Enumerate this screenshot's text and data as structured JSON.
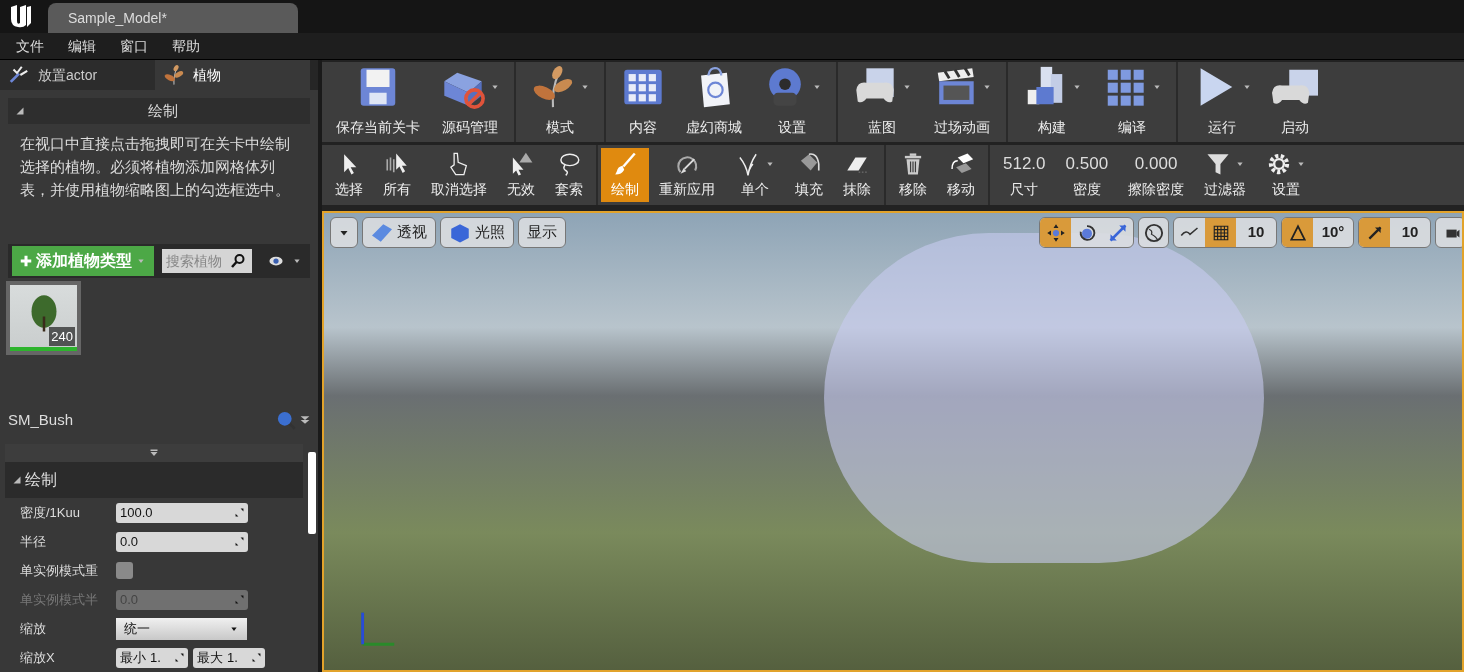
{
  "window": {
    "tab_title": "Sample_Model*"
  },
  "menu": [
    "文件",
    "编辑",
    "窗口",
    "帮助"
  ],
  "mode_tabs": [
    {
      "label": "放置actor",
      "selected": false
    },
    {
      "label": "植物",
      "selected": true
    }
  ],
  "paint_panel": {
    "header": "绘制",
    "description": "在视口中直接点击拖拽即可在关卡中绘制选择的植物。必须将植物添加网格体列表，并使用植物缩略图上的勾选框选中。",
    "add_button": "添加植物类型",
    "search": {
      "placeholder": "搜索植物"
    },
    "foliage_items": [
      {
        "count": "240",
        "selected": true
      }
    ]
  },
  "details": {
    "title": "SM_Bush",
    "section": "绘制",
    "properties": [
      {
        "kind": "number",
        "label": "密度/1Kuu",
        "value": "100.0",
        "disabled": false
      },
      {
        "kind": "number",
        "label": "半径",
        "value": "0.0",
        "disabled": false
      },
      {
        "kind": "checkbox",
        "label": "单实例模式重",
        "checked": false
      },
      {
        "kind": "number",
        "label": "单实例模式半",
        "value": "0.0",
        "disabled": true
      },
      {
        "kind": "dropdown",
        "label": "缩放",
        "value": "统一"
      },
      {
        "kind": "range",
        "label": "缩放X",
        "min_label": "最小",
        "min": "1.",
        "max_label": "最大",
        "max": "1."
      }
    ]
  },
  "main_toolbar": {
    "groups": [
      [
        {
          "label": "保存当前关卡",
          "dropdown": false
        },
        {
          "label": "源码管理",
          "dropdown": true
        }
      ],
      [
        {
          "label": "模式",
          "dropdown": true
        }
      ],
      [
        {
          "label": "内容",
          "dropdown": false
        },
        {
          "label": "虚幻商城",
          "dropdown": false
        },
        {
          "label": "设置",
          "dropdown": true
        }
      ],
      [
        {
          "label": "蓝图",
          "dropdown": true
        },
        {
          "label": "过场动画",
          "dropdown": true
        }
      ],
      [
        {
          "label": "构建",
          "dropdown": true
        },
        {
          "label": "编译",
          "dropdown": true
        }
      ],
      [
        {
          "label": "运行",
          "dropdown": true
        },
        {
          "label": "启动",
          "dropdown": false
        }
      ]
    ]
  },
  "foliage_toolbar": {
    "groups": [
      [
        {
          "kind": "tool",
          "label": "选择",
          "selected": false,
          "dropdown": false
        },
        {
          "kind": "tool",
          "label": "所有",
          "selected": false,
          "dropdown": false
        },
        {
          "kind": "tool",
          "label": "取消选择",
          "selected": false,
          "dropdown": false
        },
        {
          "kind": "tool",
          "label": "无效",
          "selected": false,
          "dropdown": false
        },
        {
          "kind": "tool",
          "label": "套索",
          "selected": false,
          "dropdown": false
        }
      ],
      [
        {
          "kind": "tool",
          "label": "绘制",
          "selected": true,
          "dropdown": false
        },
        {
          "kind": "tool",
          "label": "重新应用",
          "selected": false,
          "dropdown": false
        },
        {
          "kind": "tool",
          "label": "单个",
          "selected": false,
          "dropdown": true
        },
        {
          "kind": "tool",
          "label": "填充",
          "selected": false,
          "dropdown": false
        },
        {
          "kind": "tool",
          "label": "抹除",
          "selected": false,
          "dropdown": false
        }
      ],
      [
        {
          "kind": "tool",
          "label": "移除",
          "selected": false,
          "dropdown": false
        },
        {
          "kind": "tool",
          "label": "移动",
          "selected": false,
          "dropdown": false
        }
      ],
      [
        {
          "kind": "value",
          "value": "512.0",
          "label": "尺寸",
          "selected": false,
          "dropdown": false
        },
        {
          "kind": "value",
          "value": "0.500",
          "label": "密度",
          "selected": false,
          "dropdown": false
        },
        {
          "kind": "value",
          "value": "0.000",
          "label": "擦除密度",
          "selected": false,
          "dropdown": false
        },
        {
          "kind": "tool",
          "label": "过滤器",
          "selected": false,
          "dropdown": true
        },
        {
          "kind": "tool",
          "label": "设置",
          "selected": false,
          "dropdown": true
        }
      ]
    ]
  },
  "viewport": {
    "view_buttons": [
      "透视",
      "光照",
      "显示"
    ],
    "transform_modes": [
      {
        "selected": true
      },
      {
        "selected": false
      },
      {
        "selected": false
      }
    ],
    "snaps": [
      {
        "value": "10",
        "on": true
      },
      {
        "value": "10°",
        "on": true
      },
      {
        "value": "10",
        "on": true
      }
    ]
  }
}
